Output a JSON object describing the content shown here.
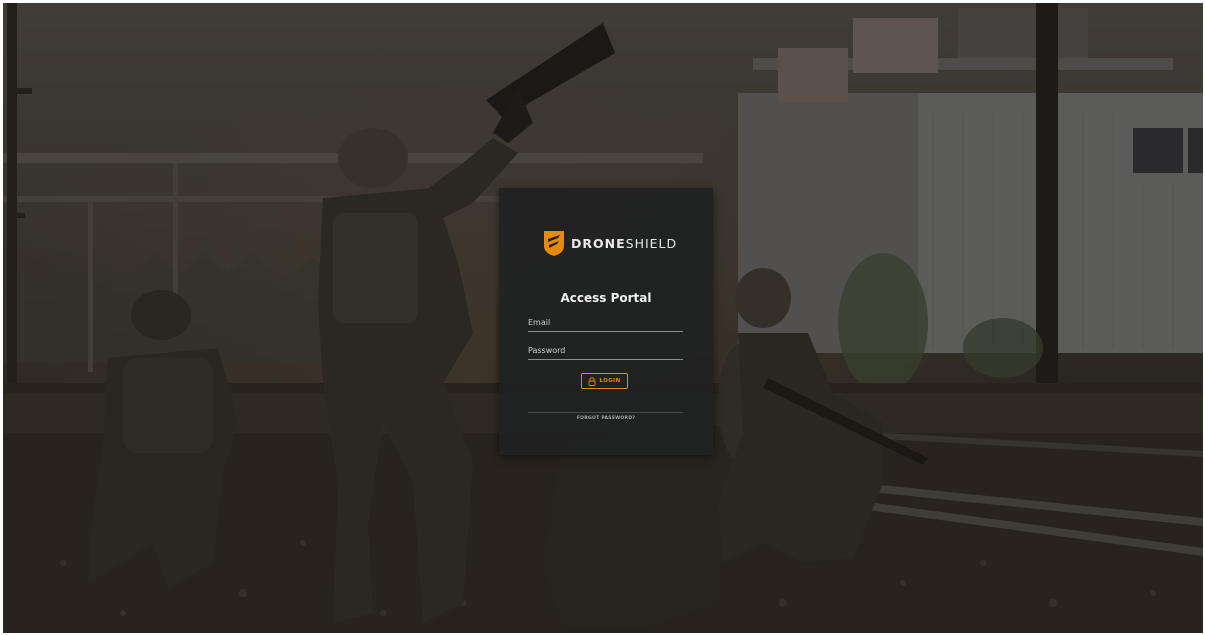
{
  "brand": {
    "name_bold": "DRONE",
    "name_light": "SHIELD",
    "logo_icon": "droneshield-shield-logo-icon",
    "accent_color": "#e6890f"
  },
  "portal": {
    "title": "Access Portal"
  },
  "form": {
    "email_placeholder": "Email",
    "password_placeholder": "Password",
    "login_label": "LOGIN",
    "login_icon": "lock-icon",
    "forgot_password_label": "FORGOT PASSWORD?"
  },
  "background": {
    "description_icon": "background-photo"
  }
}
